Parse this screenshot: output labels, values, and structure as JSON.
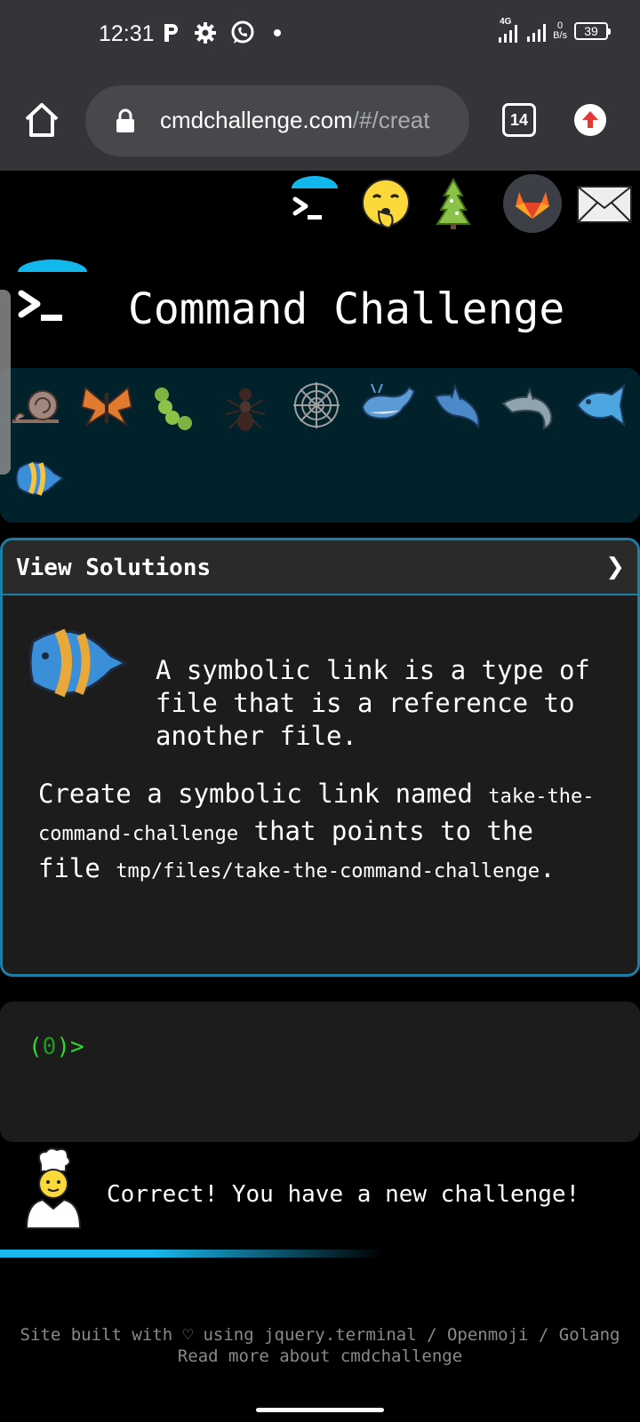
{
  "status_bar": {
    "time": "12:31",
    "network_label": "4G",
    "speed_value": "0",
    "speed_unit": "B/s",
    "battery": "39"
  },
  "browser": {
    "url_domain": "cmdchallenge.com",
    "url_path": "/#/creat",
    "tab_count": "14"
  },
  "top_icons": [
    "terminal-icon",
    "shushing-face-icon",
    "tree-icon",
    "gitlab-icon",
    "mail-icon"
  ],
  "page": {
    "title": "Command Challenge"
  },
  "levels": [
    "snail-icon",
    "butterfly-icon",
    "caterpillar-icon",
    "ant-icon",
    "spider-web-icon",
    "whale-icon",
    "shark-icon",
    "dolphin-icon",
    "fish-icon",
    "tropical-fish-icon"
  ],
  "card": {
    "header": "View Solutions",
    "chevron": "❯",
    "intro": "A symbolic link is a type of file that is a reference to another file.",
    "task_part1": "Create a symbolic link named ",
    "task_code1": "take-the-command-challenge",
    "task_part2": " that points to the file ",
    "task_code2": "tmp/files/take-the-command-challenge",
    "task_part3": "."
  },
  "terminal": {
    "prompt_open": "(",
    "prompt_num": "0",
    "prompt_close": ")>"
  },
  "result": {
    "message": "Correct! You have a new challenge!"
  },
  "footer": {
    "line1": "Site built with ♡ using jquery.terminal / Openmoji / Golang",
    "line2": "Read more about cmdchallenge"
  },
  "colors": {
    "accent": "#18b8ee",
    "card_border": "#1a7fa6",
    "prompt_green": "#2fd82f"
  }
}
